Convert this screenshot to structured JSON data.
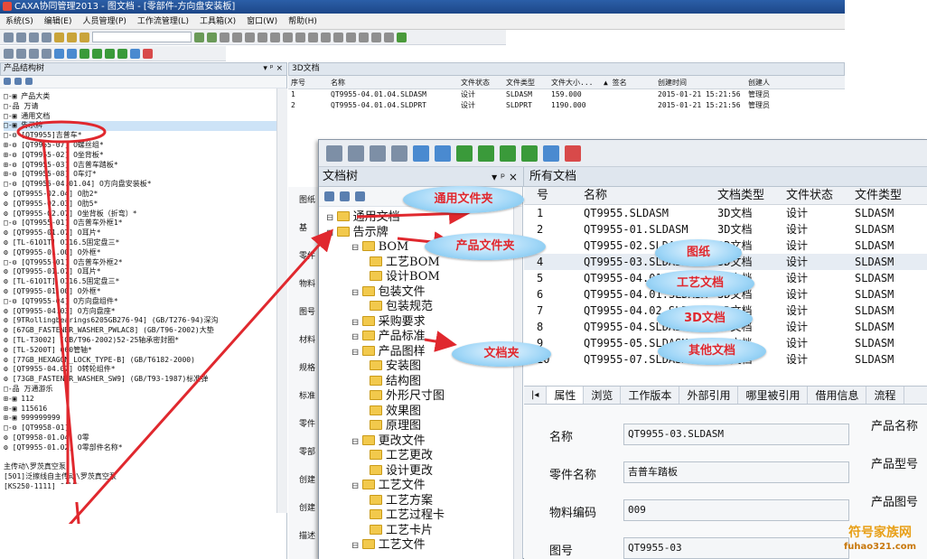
{
  "window": {
    "title": "CAXA协同管理2013 - 图文档 - [零部件-方向盘安装板]"
  },
  "menu": [
    "系统(S)",
    "编辑(E)",
    "人员管理(P)",
    "工作流管理(L)",
    "工具箱(X)",
    "窗口(W)",
    "帮助(H)"
  ],
  "left_panel": {
    "title": "产品结构树",
    "pin": "▾ ᵖ ×"
  },
  "tree": [
    "□-▣ 产品大类",
    "  □-品 万请",
    "    □-▣ 通用文档",
    "    □-▣ 告示牌",
    "      □-⚙ [QT9955]吉普车*",
    "        ⊞-⚙ [QT9955-07] O螺丝组*",
    "        ⊞-⚙ [QT9955-02] O坐背板*",
    "        ⊞-⚙ [QT9955-03] O吉普车踏板*",
    "        ⊞-⚙ [QT9955-08] O车灯*",
    "        □-⚙ [QT9955-04.01.04] O方向盘安装板*",
    "          ⚙ [QT9955-02.04] O肋2*",
    "          ⚙ [QT9955-02.03] O肋5*",
    "          ⚙ [QT9955-02.07] O坐背板（折弯）*",
    "        □-⚙ [QT9955-01] O吉普车外框1*",
    "          ⚙ [QT9955-01.07] O耳片*",
    "          ⚙ [TL-6101T] O116.5固定盘三*",
    "          ⚙ [QT9955-01.00] O外框*",
    "        □-⚙ [QT9955-01] O吉普车外框2*",
    "          ⚙ [QT9955-01.07] O耳片*",
    "          ⚙ [TL-6101T] O116.5固定盘三*",
    "          ⚙ [QT9955-01.00] O外框*",
    "        □-⚙ [QT9955-04] O方向盘组件*",
    "          ⚙ [QT9955-04.03] O方向盘座*",
    "          ⚙ [9TRollingbearings6205GB276-94] (GB/T276-94)深沟",
    "          ⚙ [67GB_FASTENER_WASHER_PWLAC8] (GB/T96-2002)大垫",
    "          ⚙ [TL-T3002] (GB/T96-2002)52-25轴承密封圈*",
    "          ⚙ [TL-5200T] O60管轴*",
    "          ⚙ [77GB_HEXAGON_LOCK_TYPE-B] (GB/T6182-2000)",
    "          ⚙ [QT9955-04.02] O转轮组件*",
    "          ⚙ [73GB_FASTENER_WASHER_SW9] (GB/T93-1987)标准弹",
    "  □-品 万通游乐",
    "      ⊞-▣ 112",
    "      ⊞-▣ 115616",
    "      ⊞-▣ 999999999",
    "      □-⚙ [QT9958-01]",
    "        ⚙ [QT9958-01.04] O零",
    "        ⚙ [QT9955-01.02] O零部件名称*",
    "",
    "      主传动\\罗茨真空泵",
    "      [501]泛擦线自主传动\\罗茨真空泵",
    "      [KS250-1111] O机体"
  ],
  "doc_header": {
    "title": "3D文档"
  },
  "top_table": {
    "columns": [
      "序号",
      "名称",
      "文件状态",
      "文件类型",
      "文件大小...",
      "▲ 签名",
      "创建时间",
      "创建人"
    ],
    "rows": [
      [
        "1",
        "QT9955-04.01.04.SLDASM",
        "设计",
        "SLDASM",
        "159.000",
        "",
        "2015-01-21 15:21:56",
        "管理员"
      ],
      [
        "2",
        "QT9955-04.01.04.SLDPRT",
        "设计",
        "SLDPRT",
        "1190.000",
        "",
        "2015-01-21 15:21:56",
        "管理员"
      ]
    ]
  },
  "side_tabs": [
    "图纸",
    "基",
    "零件",
    "物料",
    "图号",
    "材料",
    "规格",
    "标准",
    "零件",
    "零部",
    "创建",
    "创建",
    "描述"
  ],
  "doc_tree": {
    "title": "文档树",
    "pin": "▾ ᵖ ×",
    "items": [
      {
        "label": "通用文档",
        "depth": 0
      },
      {
        "label": "告示牌",
        "depth": 0
      },
      {
        "label": "BOM",
        "depth": 1
      },
      {
        "label": "工艺BOM",
        "depth": 2
      },
      {
        "label": "设计BOM",
        "depth": 2
      },
      {
        "label": "包装文件",
        "depth": 1
      },
      {
        "label": "包装规范",
        "depth": 2
      },
      {
        "label": "采购要求",
        "depth": 1
      },
      {
        "label": "产品标准",
        "depth": 1
      },
      {
        "label": "产品图样",
        "depth": 1
      },
      {
        "label": "安装图",
        "depth": 2
      },
      {
        "label": "结构图",
        "depth": 2
      },
      {
        "label": "外形尺寸图",
        "depth": 2
      },
      {
        "label": "效果图",
        "depth": 2
      },
      {
        "label": "原理图",
        "depth": 2
      },
      {
        "label": "更改文件",
        "depth": 1
      },
      {
        "label": "工艺更改",
        "depth": 2
      },
      {
        "label": "设计更改",
        "depth": 2
      },
      {
        "label": "工艺文件",
        "depth": 1
      },
      {
        "label": "工艺方案",
        "depth": 2
      },
      {
        "label": "工艺过程卡",
        "depth": 2
      },
      {
        "label": "工艺卡片",
        "depth": 2
      },
      {
        "label": "工艺文件",
        "depth": 1
      }
    ]
  },
  "all_docs": {
    "title": "所有文档",
    "columns": [
      "号",
      "名称",
      "文档类型",
      "文件状态",
      "文件类型"
    ],
    "rows": [
      [
        "1",
        "QT9955.SLDASM",
        "3D文档",
        "设计",
        "SLDASM"
      ],
      [
        "2",
        "QT9955-01.SLDASM",
        "3D文档",
        "设计",
        "SLDASM"
      ],
      [
        "3",
        "QT9955-02.SLDASM",
        "3D文档",
        "设计",
        "SLDASM"
      ],
      [
        "4",
        "QT9955-03.SLDASM",
        "3D文档",
        "设计",
        "SLDASM"
      ],
      [
        "5",
        "QT9955-04.01.SLDASM",
        "3D文档",
        "设计",
        "SLDASM"
      ],
      [
        "6",
        "QT9955-04.01.SLDASM",
        "3D文档",
        "设计",
        "SLDASM"
      ],
      [
        "7",
        "QT9955-04.02.SLDASM",
        "3D文档",
        "设计",
        "SLDASM"
      ],
      [
        "8",
        "QT9955-04.SLDASM",
        "3D文档",
        "设计",
        "SLDASM"
      ],
      [
        "9",
        "QT9955-05.SLDASM",
        "3D文档",
        "设计",
        "SLDASM"
      ],
      [
        "10",
        "QT9955-07.SLDASM",
        "3D文档",
        "设计",
        "SLDASM"
      ]
    ]
  },
  "props": {
    "tabs": [
      "属性",
      "浏览",
      "工作版本",
      "外部引用",
      "哪里被引用",
      "借用信息",
      "流程"
    ],
    "fields": [
      {
        "label": "名称",
        "value": "QT9955-03.SLDASM"
      },
      {
        "label": "零件名称",
        "value": "吉普车踏板"
      },
      {
        "label": "物料编码",
        "value": "009"
      },
      {
        "label": "图号",
        "value": "QT9955-03"
      }
    ],
    "right_labels": [
      "产品名称",
      "产品型号",
      "产品图号"
    ]
  },
  "annotations": {
    "general_folder": "通用文件夹",
    "product_folder": "产品文件夹",
    "doc_folder": "文档夹",
    "drawing": "图纸",
    "process_doc": "工艺文档",
    "doc3d": "3D文档",
    "other_doc": "其他文档"
  },
  "watermark": {
    "line1": "符号家族网",
    "line2": "fuhao321.com"
  },
  "colors": {
    "annotation_red": "#e0282e",
    "bubble_blue": "#9fd6f7",
    "selection": "#cde3f7"
  }
}
